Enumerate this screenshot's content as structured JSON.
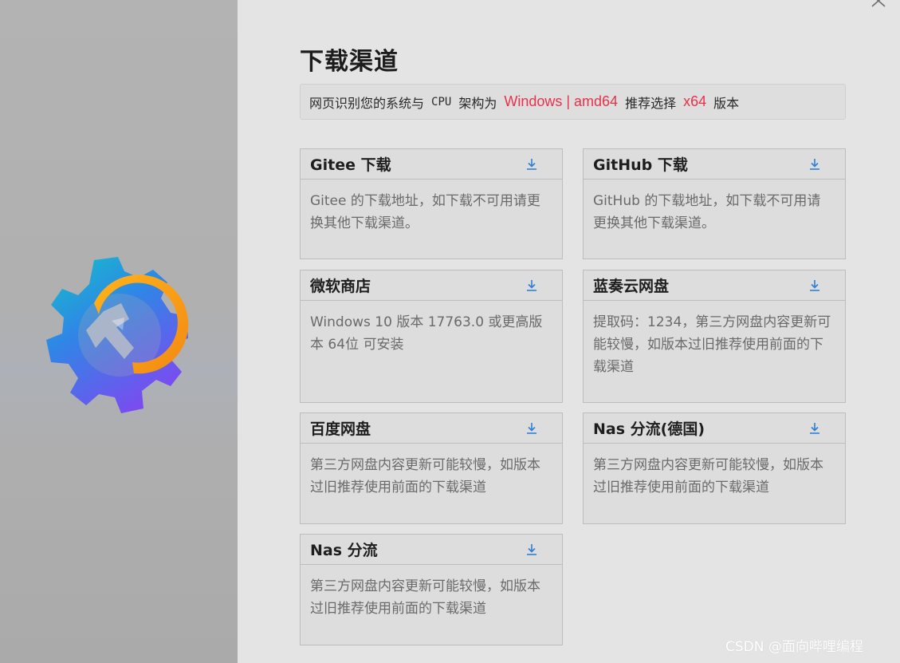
{
  "page": {
    "title": "下载渠道"
  },
  "info": {
    "prefix": "网页识别您的系统与",
    "cpu": "CPU",
    "mid": "架构为",
    "system": "Windows | amd64",
    "recommend": "推荐选择",
    "arch": "x64",
    "suffix": "版本"
  },
  "cards": [
    {
      "title": "Gitee 下载",
      "desc": "Gitee 的下载地址，如下载不可用请更换其他下载渠道。"
    },
    {
      "title": "GitHub 下载",
      "desc": "GitHub 的下载地址，如下载不可用请更换其他下载渠道。"
    },
    {
      "title": "微软商店",
      "desc": "Windows 10 版本 17763.0 或更高版本 64位 可安装"
    },
    {
      "title": "蓝奏云网盘",
      "desc": "提取码：1234，第三方网盘内容更新可能较慢，如版本过旧推荐使用前面的下载渠道"
    },
    {
      "title": "百度网盘",
      "desc": "第三方网盘内容更新可能较慢，如版本过旧推荐使用前面的下载渠道"
    },
    {
      "title": "Nas 分流(德国)",
      "desc": "第三方网盘内容更新可能较慢，如版本过旧推荐使用前面的下载渠道"
    },
    {
      "title": "Nas 分流",
      "desc": "第三方网盘内容更新可能较慢，如版本过旧推荐使用前面的下载渠道"
    }
  ],
  "icons": {
    "close": "close-icon",
    "download": "download-icon",
    "logo": "gear-wrench-logo"
  },
  "colors": {
    "highlight": "#e8324a",
    "download_icon": "#2f7fd6"
  },
  "watermark": "CSDN @面向哔哩编程"
}
